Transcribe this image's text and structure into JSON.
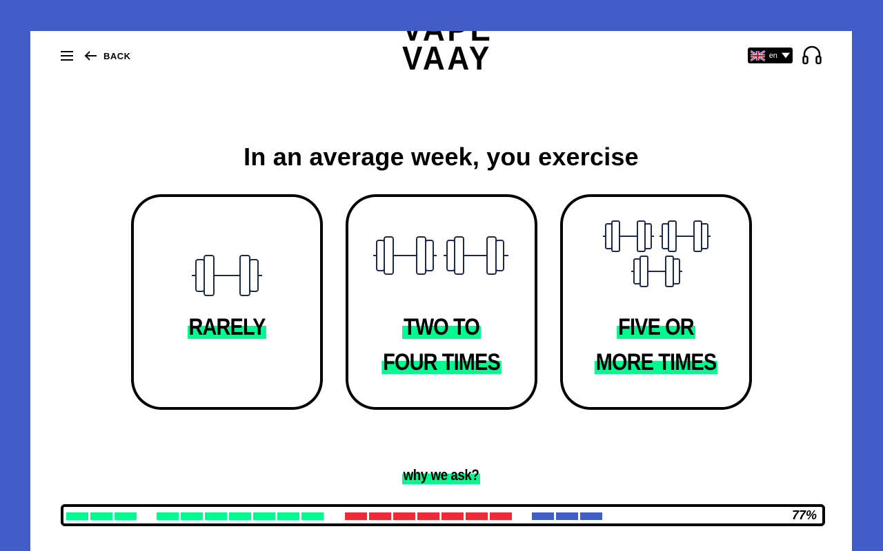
{
  "header": {
    "back_label": "BACK",
    "logo_lines": [
      "VAPE",
      "VAAY"
    ],
    "language": {
      "code": "en",
      "flag": "uk-flag-icon"
    },
    "icons": {
      "menu": "hamburger-menu-icon",
      "back": "arrow-left-icon",
      "audio": "headphones-icon",
      "dropdown": "caret-down-icon"
    }
  },
  "question": "In an average week, you exercise",
  "options": [
    {
      "line1": "RARELY",
      "line2": "",
      "icon": "single-dumbbell-icon"
    },
    {
      "line1": "TWO TO",
      "line2": "FOUR TIMES",
      "icon": "two-dumbbells-icon"
    },
    {
      "line1": "FIVE OR",
      "line2": "MORE TIMES",
      "icon": "three-dumbbells-icon"
    }
  ],
  "why_link": "why we ask?",
  "progress": {
    "value_text": "77%",
    "colors": {
      "green": "#00fa8f",
      "red": "#ee2939",
      "blue": "#415dc9"
    },
    "groups": [
      {
        "color": "green",
        "segments": 3
      },
      {
        "color": "green",
        "segments": 7
      },
      {
        "color": "red",
        "segments": 7
      },
      {
        "color": "blue",
        "segments": 3
      }
    ]
  },
  "colors": {
    "background": "#415dc9",
    "accent": "#00fa8f",
    "panel": "#ffffff",
    "ink": "#000000",
    "icon_stroke": "#1b2a4a"
  }
}
